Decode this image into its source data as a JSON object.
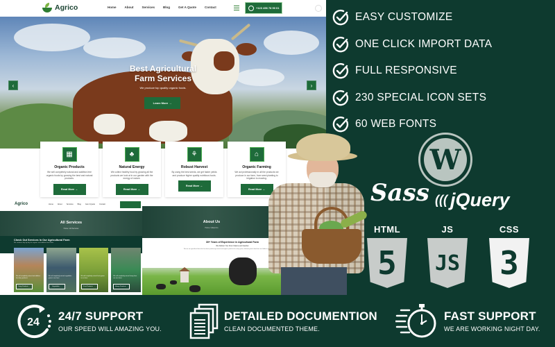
{
  "site": {
    "logo_text": "Agrico",
    "nav_links": [
      "Home",
      "About",
      "Services",
      "Blog",
      "Get A Quote",
      "Contact"
    ],
    "phone": "+123 456 78 90 01",
    "hero": {
      "title_line1": "Best Agricultural",
      "title_line2": "Farm Services",
      "subtitle": "We produce top quality organic foods.",
      "button": "Learn More →",
      "prev_arrow": "‹",
      "next_arrow": "›"
    },
    "service_cards": [
      {
        "title": "Organic Products",
        "text": "We sell completely natural and additive-free organic foods by growing the best and natural products.",
        "button": "Read More →",
        "icon": "produce-jars-icon"
      },
      {
        "title": "Natural Energy",
        "text": "We collect healthy food by growing all the products we look at in our garden with the energy of nature.",
        "button": "Read More →",
        "icon": "trees-icon"
      },
      {
        "title": "Robust Harvest",
        "text": "By using the best seeds, we get faster yields and produce higher quality nutritious foods.",
        "button": "Read More →",
        "icon": "sprout-soil-icon"
      },
      {
        "title": "Organic Farming",
        "text": "We act professionally in all the products we produce in our farm, from seed planting to irrigation to mowing.",
        "button": "Read More →",
        "icon": "barn-icon"
      }
    ]
  },
  "services_page": {
    "logo_text": "Agrico",
    "nav_links": [
      "Home",
      "About",
      "Services",
      "Blog",
      "Get A Quote",
      "Contact"
    ],
    "banner_title": "All Services",
    "breadcrumb": "Home / All Services",
    "heading": "Check Out Services In Our Agricultural Farm",
    "subheading": "We continue day by day for organic and additive free foods.",
    "cards": [
      {
        "caption": "We sell completely natural and additive-free dairy products.",
        "button": "Dairy Products →"
      },
      {
        "caption": "We sell completely natural vegetables grown in our farm.",
        "button": "Vegetables →"
      },
      {
        "caption": "We sell completely natural fruits grown in our farm.",
        "button": "Fruit Products →"
      },
      {
        "caption": "We sell completely natural honey from our own hives.",
        "button": "Honey Products →"
      }
    ]
  },
  "about_page": {
    "banner_title": "About Us",
    "breadcrumb": "Home / About Us",
    "heading": "30+ Years of Experience in Agricultural Farm",
    "subheading": "We Deliver You From Nature and Garden",
    "paragraph": "We are an agricultural farm that has been producing natural and organic products for many years, delivering fresh food from our fields to your table."
  },
  "features": [
    {
      "label": "EASY CUSTOMIZE",
      "icon": "check-circle-icon"
    },
    {
      "label": "ONE CLICK IMPORT DATA",
      "icon": "check-circle-icon"
    },
    {
      "label": "FULL RESPONSIVE",
      "icon": "check-circle-icon"
    },
    {
      "label": "230 SPECIAL ICON SETS",
      "icon": "check-circle-icon"
    },
    {
      "label": "60 WEB FONTS",
      "icon": "check-circle-icon"
    }
  ],
  "tech": {
    "wordpress": "W",
    "sass": "Sass",
    "jquery": "jQuery",
    "badges": [
      {
        "label": "HTML",
        "glyph": "5"
      },
      {
        "label": "JS",
        "glyph": "JS"
      },
      {
        "label": "CSS",
        "glyph": "3"
      }
    ]
  },
  "bottom_bar": [
    {
      "icon": "24-hour-clock-icon",
      "icon_text": "24",
      "title": "24/7 SUPPORT",
      "subtitle": "OUR SPEED WILL AMAZING YOU."
    },
    {
      "icon": "documents-icon",
      "title": "DETAILED DOCUMENTION",
      "subtitle": "CLEAN DOCUMENTED THEME."
    },
    {
      "icon": "stopwatch-icon",
      "title": "FAST SUPPORT",
      "subtitle": "WE ARE WORKING NIGHT DAY."
    }
  ],
  "colors": {
    "brand_dark": "#0e3a2f",
    "brand_green": "#1e6b3a",
    "text_light": "#ffffff",
    "icon_grey": "#c8ccca"
  }
}
